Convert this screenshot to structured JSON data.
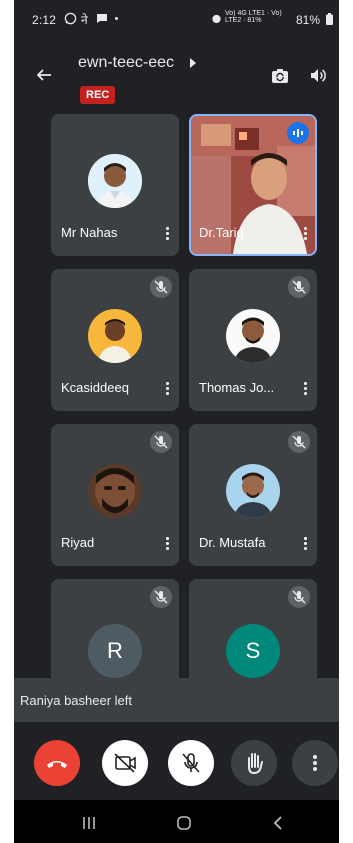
{
  "status_bar": {
    "time": "2:12",
    "right_text": "Vo) 4G LTE1 · Vo) LTE2 · 81%",
    "battery": "81%"
  },
  "header": {
    "meeting_title": "ewn-teec-eec",
    "rec_label": "REC"
  },
  "participants": [
    {
      "name": "Mr Nahas",
      "muted": false,
      "has_video": false,
      "letter": ""
    },
    {
      "name": "Dr.Tariq",
      "muted": false,
      "has_video": true,
      "letter": ""
    },
    {
      "name": "Kcasiddeeq",
      "muted": true,
      "has_video": false,
      "letter": ""
    },
    {
      "name": "Thomas Jo...",
      "muted": true,
      "has_video": false,
      "letter": ""
    },
    {
      "name": "Riyad",
      "muted": true,
      "has_video": false,
      "letter": ""
    },
    {
      "name": "Dr. Mustafa",
      "muted": true,
      "has_video": false,
      "letter": ""
    },
    {
      "name": "",
      "muted": true,
      "has_video": false,
      "letter": "R"
    },
    {
      "name": "",
      "muted": true,
      "has_video": false,
      "letter": "S"
    }
  ],
  "toast": {
    "text": "Raniya basheer left"
  },
  "colors": {
    "background": "#202124",
    "tile": "#3c4043",
    "rec": "#c5221f",
    "end_call": "#ea4335",
    "active_speaker": "#1a73e8",
    "avatar_r": "#4f5b62",
    "avatar_s": "#00897b"
  },
  "icons": {
    "back": "arrow-left-icon",
    "switch_camera": "switch-camera-icon",
    "speaker": "speaker-icon",
    "mic_off": "mic-off-icon",
    "more": "more-vertical-icon",
    "end_call": "end-call-icon",
    "camera_off": "camera-off-icon",
    "raise_hand": "raise-hand-icon"
  }
}
